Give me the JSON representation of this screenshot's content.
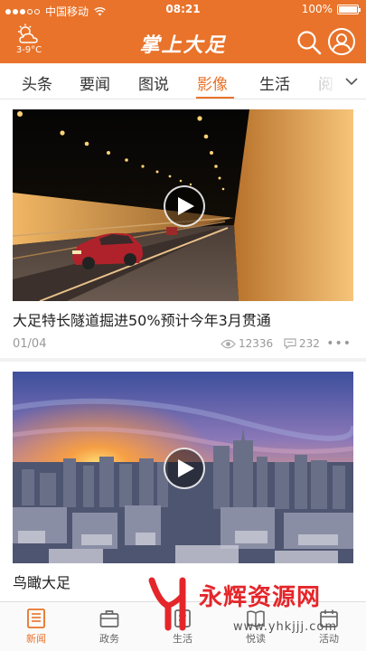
{
  "status_bar": {
    "carrier": "中国移动",
    "time": "08:21",
    "battery": "100%",
    "battery_level": 1.0,
    "signal_bars_filled": 3,
    "signal_bars_total": 5
  },
  "header": {
    "weather_icon": "cloud-sun-icon",
    "temperature": "3-9°C",
    "title": "掌上大足",
    "search_icon": "search-icon",
    "user_icon": "user-icon"
  },
  "tabs": {
    "items": [
      "头条",
      "要闻",
      "图说",
      "影像",
      "生活",
      "阅"
    ],
    "active": "影像",
    "more_icon": "chevron-down-icon"
  },
  "feed": [
    {
      "title": "大足特长隧道掘进50%预计今年3月贯通",
      "date": "01/04",
      "views": "12336",
      "comments": "232",
      "more": "•••"
    },
    {
      "title": "鸟瞰大足"
    }
  ],
  "tabbar": {
    "items": [
      {
        "label": "新闻",
        "icon": "newspaper-icon"
      },
      {
        "label": "政务",
        "icon": "briefcase-icon"
      },
      {
        "label": "生活",
        "icon": "life-icon"
      },
      {
        "label": "悦读",
        "icon": "book-icon"
      },
      {
        "label": "活动",
        "icon": "activity-icon"
      }
    ],
    "active": "新闻"
  },
  "watermark": {
    "text": "永辉资源网",
    "url": "www.yhkjjj.com"
  },
  "colors": {
    "brand": "#e9732a",
    "watermark": "#e4262a"
  }
}
